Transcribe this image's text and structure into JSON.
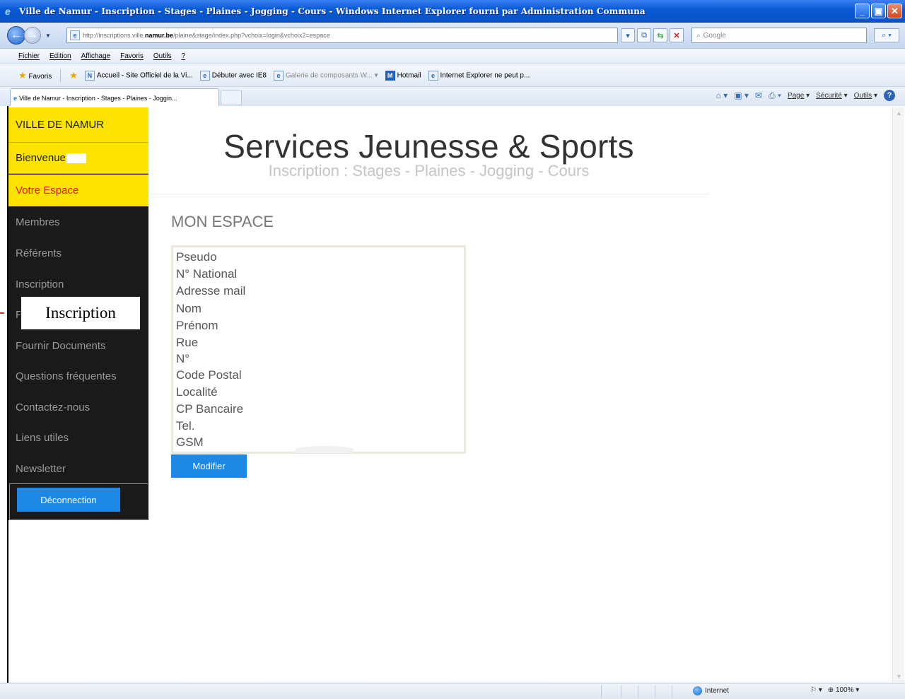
{
  "window": {
    "title": "Ville de Namur - Inscription - Stages - Plaines - Jogging - Cours - Windows Internet Explorer fourni par Administration Communa",
    "controls": {
      "minimize": "_",
      "restore": "▣",
      "close": "✕"
    }
  },
  "address_bar": {
    "url_prefix": "http://inscriptions.ville.",
    "url_domain": "namur.be",
    "url_path": "/plaine&stage/index.php?vchoix=login&vchoix2=espace",
    "search_placeholder": "Google"
  },
  "menu": [
    "Fichier",
    "Edition",
    "Affichage",
    "Favoris",
    "Outils",
    "?"
  ],
  "favorites_bar": {
    "favoris_label": "Favoris",
    "items": [
      {
        "label": "Accueil - Site Officiel de la Vi...",
        "icon": "namur-site-icon"
      },
      {
        "label": "Débuter avec IE8",
        "icon": "ie-page-icon"
      },
      {
        "label": "Galerie de composants W...",
        "icon": "ie-page-icon"
      },
      {
        "label": "Hotmail",
        "icon": "hotmail-icon"
      },
      {
        "label": "Internet Explorer ne peut p...",
        "icon": "ie-page-icon"
      }
    ]
  },
  "tabs": [
    {
      "label": "Ville de Namur - Inscription - Stages - Plaines - Joggin..."
    }
  ],
  "command_bar": {
    "page": "Page",
    "securite": "Sécurité",
    "outils": "Outils"
  },
  "sidebar": {
    "brand": "VILLE DE NAMUR",
    "welcome": "Bienvenue",
    "active": "Votre Espace",
    "items": [
      "Membres",
      "Référents",
      "Inscription",
      "F",
      "Fournir Documents",
      "Questions fréquentes",
      "Contactez-nous",
      "Liens utiles",
      "Newsletter"
    ],
    "logout": "Déconnection"
  },
  "tooltip": {
    "text": "Inscription"
  },
  "header": {
    "title": "Services Jeunesse & Sports",
    "subtitle": "Inscription : Stages - Plaines - Jogging - Cours"
  },
  "main": {
    "section_title": "MON ESPACE",
    "fields": [
      "Pseudo",
      "N° National",
      "Adresse mail",
      "Nom",
      "Prénom",
      "Rue",
      "N°",
      "Code Postal",
      "Localité",
      "CP Bancaire",
      "Tel.",
      "GSM"
    ],
    "modify_button": "Modifier"
  },
  "status_bar": {
    "zone": "Internet",
    "zoom": "100%"
  },
  "colors": {
    "sidebar_bg": "#1a1a1a",
    "sidebar_yellow": "#fde400",
    "active_red": "#e5140f",
    "button_blue": "#1e88e5"
  }
}
